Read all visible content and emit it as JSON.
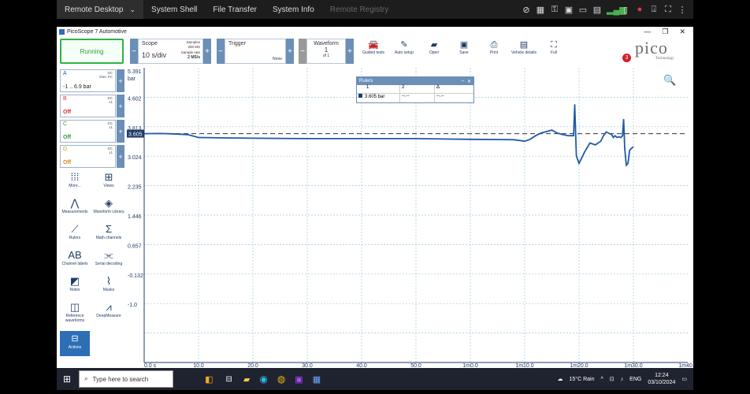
{
  "remote_bar": {
    "items": [
      "Remote Desktop",
      "System Shell",
      "File Transfer",
      "System Info",
      "Remote Registry"
    ]
  },
  "window": {
    "title": "PicoScope 7 Automotive"
  },
  "toolbar": {
    "run_label": "Running",
    "scope_label": "Scope",
    "timebase": "10 s/div",
    "samples_label": "Samples",
    "samples_value": "200 MS",
    "sample_rate_label": "Sample rate",
    "sample_rate_value": "2 MS/s",
    "trigger_label": "Trigger",
    "trigger_mode": "None",
    "waveform_label": "Waveform",
    "waveform_index": "1",
    "waveform_total": "of 1",
    "tools": [
      "Guided tests",
      "Auto setup",
      "Open",
      "Save",
      "Print",
      "Vehicle details",
      "Full"
    ],
    "notification_count": "3",
    "logo_text": "pico",
    "logo_sub": "Technology"
  },
  "channels": [
    {
      "name": "A",
      "coupling": "DC",
      "probe": "Dtec PC",
      "range": "-1 .. 6.9 bar",
      "color": "#1f5aa6"
    },
    {
      "name": "B",
      "coupling": "DC",
      "probe": "x1",
      "range": "Off",
      "color": "#d6332f"
    },
    {
      "name": "C",
      "coupling": "DC",
      "probe": "x1",
      "range": "Off",
      "color": "#2a9d3c"
    },
    {
      "name": "D",
      "coupling": "DC",
      "probe": "x1",
      "range": "Off",
      "color": "#d98a12"
    }
  ],
  "side_tools": [
    {
      "label": "More...",
      "icon": "grid-dots-icon"
    },
    {
      "label": "Views",
      "icon": "views-grid-icon"
    },
    {
      "label": "Measurements",
      "icon": "measurement-icon"
    },
    {
      "label": "Waveform Library",
      "icon": "library-icon"
    },
    {
      "label": "Rulers",
      "icon": "ruler-icon"
    },
    {
      "label": "Math channels",
      "icon": "sigma-icon"
    },
    {
      "label": "Channel labels",
      "icon": "abcd-icon"
    },
    {
      "label": "Serial decoding",
      "icon": "serial-icon"
    },
    {
      "label": "Notes",
      "icon": "note-icon"
    },
    {
      "label": "Masks",
      "icon": "mask-icon"
    },
    {
      "label": "Reference waveforms",
      "icon": "reference-icon"
    },
    {
      "label": "DeepMeasure",
      "icon": "deepmeasure-icon"
    },
    {
      "label": "Actions",
      "icon": "actions-icon"
    }
  ],
  "rulers": {
    "title": "Rulers",
    "headers": [
      "1",
      "2",
      "Δ"
    ],
    "row": [
      "3.605 bar",
      "--.--",
      "--.--"
    ]
  },
  "chart_data": {
    "type": "line",
    "title": "",
    "xlabel": "",
    "ylabel": "bar",
    "xlim": [
      0,
      100
    ],
    "ylim": [
      -2.6,
      5.391
    ],
    "y_ticks": [
      "5.391",
      "4.602",
      "3.813",
      "3.024",
      "2.235",
      "1.446",
      "0.657",
      "-0.132",
      "-1.0"
    ],
    "x_ticks": [
      "0.0 s",
      "10.0",
      "20.0",
      "30.0",
      "40.0",
      "50.0",
      "1m0.0",
      "1m10.0",
      "1m20.0",
      "1m30.0",
      "1m40.0"
    ],
    "cursor_value": "3.605",
    "ruler_level": 3.605,
    "grid": true,
    "series": [
      {
        "color": "#1f5aa6",
        "x": [
          0,
          3,
          5,
          8,
          10,
          15,
          20,
          30,
          40,
          50,
          55,
          60,
          68,
          70,
          71,
          72,
          73,
          75,
          76,
          77,
          78,
          79,
          79.2,
          79.5,
          80,
          81,
          82,
          83,
          84,
          84.5,
          85,
          86,
          86.3,
          86.6,
          87,
          87.3,
          87.7,
          88,
          88.2,
          88.4,
          88.7,
          89,
          89.3,
          89.6,
          90
        ],
        "y": [
          3.605,
          3.61,
          3.6,
          3.58,
          3.5,
          3.49,
          3.48,
          3.47,
          3.47,
          3.47,
          3.46,
          3.45,
          3.44,
          3.4,
          3.45,
          3.55,
          3.62,
          3.7,
          3.62,
          3.58,
          3.55,
          3.55,
          4.4,
          3.0,
          2.8,
          3.1,
          3.35,
          3.3,
          3.4,
          3.55,
          3.65,
          3.58,
          3.5,
          3.55,
          3.5,
          3.52,
          3.5,
          3.55,
          4.0,
          3.2,
          2.75,
          2.8,
          3.15,
          3.2,
          3.25
        ]
      }
    ]
  },
  "taskbar": {
    "search_placeholder": "Type here to search",
    "weather": "15°C Rain",
    "language": "ENG",
    "time": "12:24",
    "date": "03/10/2024",
    "notification_count": "2"
  }
}
